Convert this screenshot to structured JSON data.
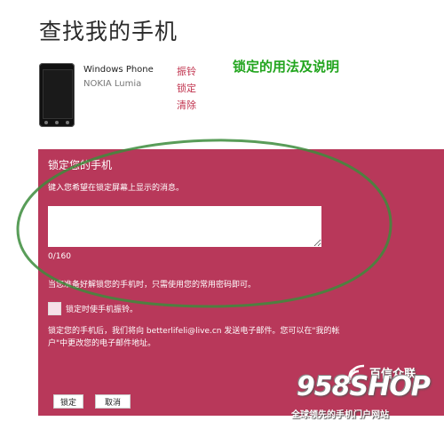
{
  "page": {
    "title": "查找我的手机"
  },
  "device": {
    "name": "Windows Phone",
    "model": "NOKIA Lumia",
    "actions": [
      "振铃",
      "锁定",
      "清除"
    ]
  },
  "caption": "锁定的用法及说明",
  "lock_panel": {
    "title": "锁定您的手机",
    "instruction": "键入您希望在锁定屏幕上显示的消息。",
    "message_value": "",
    "counter": "0/160",
    "note": "当您准备好解锁您的手机时，只需使用您的常用密码即可。",
    "checkbox_label": "锁定时使手机振铃。",
    "checkbox_checked": false,
    "email_note": "锁定您的手机后，我们将向 betterlifeli@live.cn 发送电子邮件。您可以在\"我的帐户\"中更改您的电子邮件地址。",
    "lock_button": "锁定",
    "cancel_button": "取消"
  },
  "watermark": {
    "logo": "958SHOP",
    "brand": "百信众联",
    "tagline": "全球领先的手机门户网站"
  },
  "colors": {
    "panel": "#b8385a",
    "link": "#c0324d",
    "caption": "#22a51e",
    "annotation": "#3c8c3c"
  }
}
